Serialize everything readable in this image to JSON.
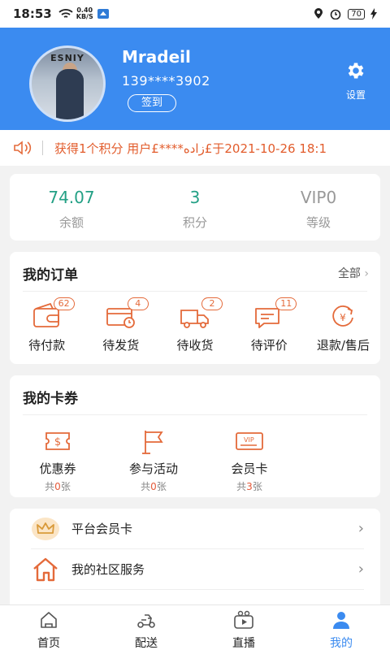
{
  "status_bar": {
    "time": "18:53",
    "net_speed_value": "0.40",
    "net_speed_unit": "KB/S",
    "battery": "70"
  },
  "profile": {
    "username": "Mradeil",
    "phone": "139****3902",
    "checkin_label": "签到",
    "settings_label": "设置",
    "avatar_text": "ESNIY"
  },
  "notice": {
    "text": "获得1个积分  用户£****زاده£于2021-10-26 18:1"
  },
  "stats": [
    {
      "value": "74.07",
      "label": "余额"
    },
    {
      "value": "3",
      "label": "积分"
    },
    {
      "value": "VIP0",
      "label": "等级"
    }
  ],
  "orders": {
    "title": "我的订单",
    "more_label": "全部",
    "items": [
      {
        "label": "待付款",
        "badge": "62",
        "icon": "wallet-icon"
      },
      {
        "label": "待发货",
        "badge": "4",
        "icon": "card-clock-icon"
      },
      {
        "label": "待收货",
        "badge": "2",
        "icon": "truck-icon"
      },
      {
        "label": "待评价",
        "badge": "11",
        "icon": "comment-icon"
      },
      {
        "label": "退款/售后",
        "badge": "",
        "icon": "refund-yen-icon"
      }
    ]
  },
  "coupons": {
    "title": "我的卡券",
    "items": [
      {
        "label": "优惠券",
        "prefix": "共",
        "count": "0",
        "suffix": "张",
        "icon": "coupon-dollar-icon"
      },
      {
        "label": "参与活动",
        "prefix": "共",
        "count": "0",
        "suffix": "张",
        "icon": "flag-icon"
      },
      {
        "label": "会员卡",
        "prefix": "共",
        "count": "3",
        "suffix": "张",
        "icon": "vip-card-icon"
      }
    ]
  },
  "menu": [
    {
      "label": "平台会员卡",
      "icon": "crown-icon"
    },
    {
      "label": "我的社区服务",
      "icon": "house-icon"
    }
  ],
  "tabbar": [
    {
      "label": "首页",
      "icon": "home-icon"
    },
    {
      "label": "配送",
      "icon": "scooter-icon"
    },
    {
      "label": "直播",
      "icon": "live-tv-icon"
    },
    {
      "label": "我的",
      "icon": "user-icon",
      "active": true
    }
  ],
  "colors": {
    "primary": "#3b8bf0",
    "stat_value": "#23a085",
    "accent": "#e46a3a",
    "notice": "#e25c2c"
  }
}
